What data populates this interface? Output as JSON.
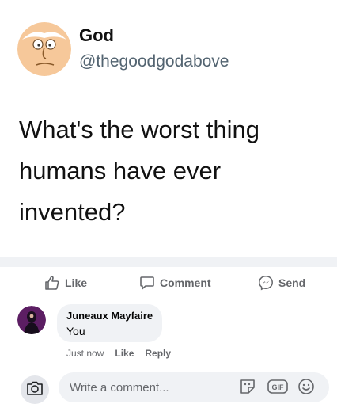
{
  "tweet": {
    "name": "God",
    "handle": "@thegoodgodabove",
    "text_line1": "What's the worst thing",
    "text_line2": "humans have ever",
    "text_line3": "invented?"
  },
  "actions": {
    "like": "Like",
    "comment": "Comment",
    "send": "Send"
  },
  "comment": {
    "author": "Juneaux Mayfaire",
    "text": "You",
    "time": "Just now",
    "like": "Like",
    "reply": "Reply"
  },
  "composer": {
    "placeholder": "Write a comment...",
    "gif": "GIF"
  },
  "icons": {
    "like": "thumbs-up-icon",
    "comment": "speech-bubble-icon",
    "send": "messenger-icon",
    "camera": "camera-icon",
    "sticker": "sticker-icon",
    "gif": "gif-icon",
    "emoji": "emoji-icon"
  },
  "colors": {
    "accent_gray": "#65676b",
    "bubble_bg": "#f0f2f5",
    "avatar_skin": "#f6c89a"
  }
}
